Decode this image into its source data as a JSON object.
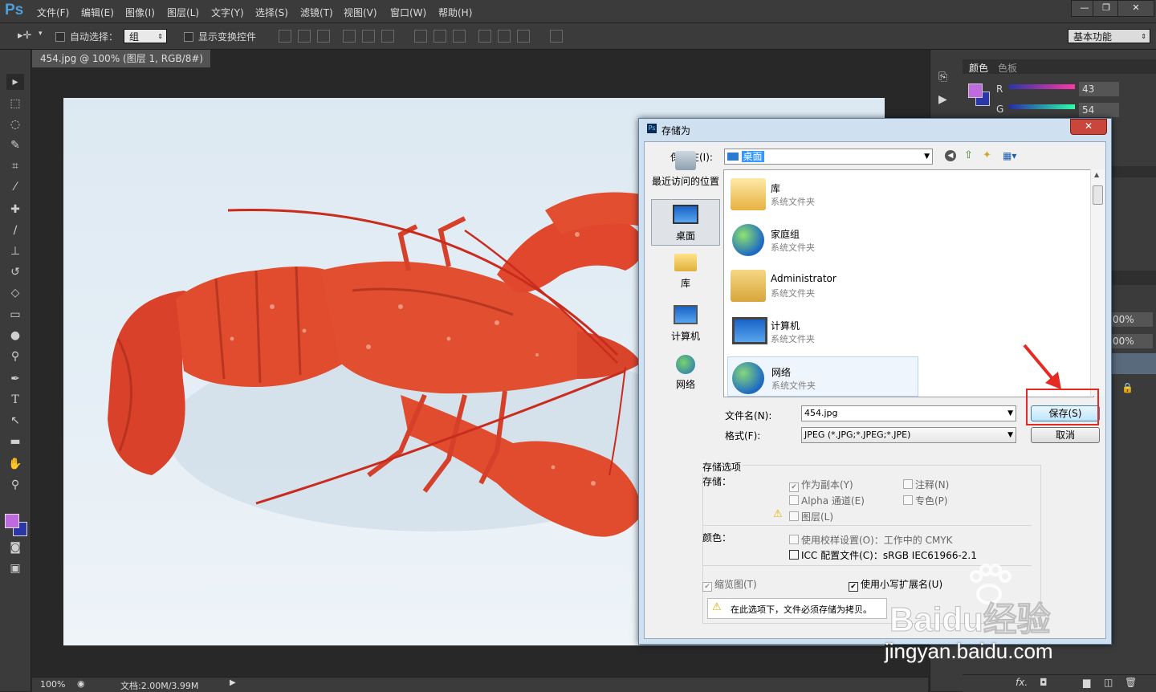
{
  "app": {
    "logo": "Ps"
  },
  "menu": [
    "文件(F)",
    "编辑(E)",
    "图像(I)",
    "图层(L)",
    "文字(Y)",
    "选择(S)",
    "滤镜(T)",
    "视图(V)",
    "窗口(W)",
    "帮助(H)"
  ],
  "window_controls": {
    "minimize": "—",
    "restore": "❐",
    "close": "✕"
  },
  "options_bar": {
    "auto_select_label": "自动选择：",
    "auto_select_value": "组",
    "show_transform_label": "显示变换控件",
    "workspace": "基本功能"
  },
  "document_tab": {
    "title": "454.jpg @ 100% (图层 1, RGB/8#) *",
    "close": "×"
  },
  "status_bar": {
    "zoom": "100%",
    "doc_info": "文档:2.00M/3.99M"
  },
  "color_panel": {
    "tabs": [
      "颜色",
      "色板"
    ],
    "channels": [
      {
        "label": "R",
        "value": "43"
      },
      {
        "label": "G",
        "value": "54"
      }
    ],
    "fg_color": "#c06ae0",
    "bg_color": "#2b36a8"
  },
  "layers_partial": {
    "opacity": "00%",
    "fill": "00%"
  },
  "dialog": {
    "title": "存储为",
    "close": "✕",
    "save_in_label": "保存在(I):",
    "save_in_value": "桌面",
    "places": [
      {
        "label": "最近访问的位置",
        "icon": "recent-places-icon"
      },
      {
        "label": "桌面",
        "icon": "desktop-icon"
      },
      {
        "label": "库",
        "icon": "library-icon"
      },
      {
        "label": "计算机",
        "icon": "computer-icon"
      },
      {
        "label": "网络",
        "icon": "network-icon"
      }
    ],
    "files": [
      {
        "name": "库",
        "type": "系统文件夹",
        "icon": "library-folder-icon"
      },
      {
        "name": "家庭组",
        "type": "系统文件夹",
        "icon": "homegroup-icon"
      },
      {
        "name": "Administrator",
        "type": "系统文件夹",
        "icon": "user-folder-icon"
      },
      {
        "name": "计算机",
        "type": "系统文件夹",
        "icon": "computer-icon"
      },
      {
        "name": "网络",
        "type": "系统文件夹",
        "icon": "network-icon"
      }
    ],
    "filename_label": "文件名(N):",
    "filename_value": "454.jpg",
    "format_label": "格式(F):",
    "format_value": "JPEG (*.JPG;*.JPEG;*.JPE)",
    "save_button": "保存(S)",
    "cancel_button": "取消",
    "options_title": "存储选项",
    "save_group_label": "存储：",
    "opt_as_copy": "作为副本(Y)",
    "opt_notes": "注释(N)",
    "opt_alpha": "Alpha 通道(E)",
    "opt_spot": "专色(P)",
    "opt_layers": "图层(L)",
    "color_group_label": "颜色：",
    "opt_proof": "使用校样设置(O)：工作中的 CMYK",
    "opt_icc": "ICC 配置文件(C)：sRGB IEC61966-2.1",
    "opt_thumbnail": "缩览图(T)",
    "opt_lowercase": "使用小写扩展名(U)",
    "warning": "在此选项下，文件必须存储为拷贝。"
  },
  "watermark": {
    "brand": "Baidu经验",
    "url": "jingyan.baidu.com"
  }
}
